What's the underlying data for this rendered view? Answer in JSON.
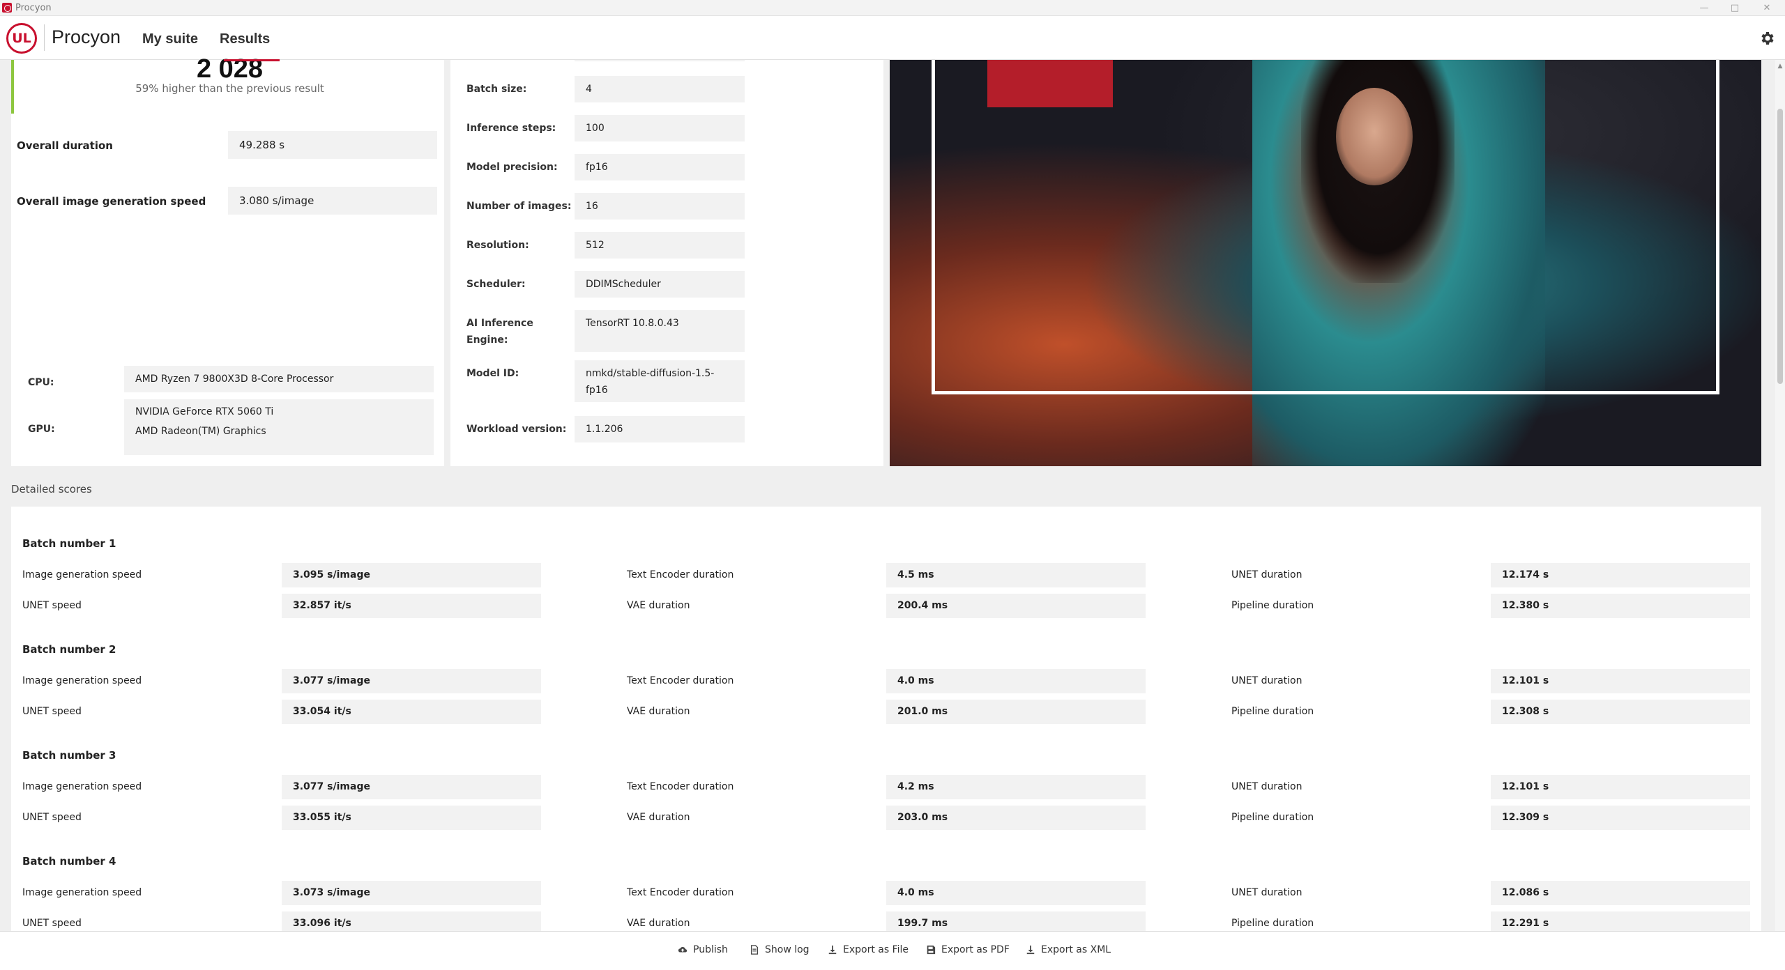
{
  "window": {
    "title": "Procyon"
  },
  "header": {
    "brand": "Procyon",
    "logo_text": "UL",
    "nav": [
      "My suite",
      "Results"
    ]
  },
  "summary": {
    "score": "2 028",
    "score_note": "59% higher than the previous result",
    "overall_duration_label": "Overall duration",
    "overall_duration_value": "49.288 s",
    "overall_speed_label": "Overall image generation speed",
    "overall_speed_value": "3.080 s/image",
    "cpu_label": "CPU:",
    "cpu_value": "AMD Ryzen 7 9800X3D 8-Core Processor",
    "gpu_label": "GPU:",
    "gpu_value_1": "NVIDIA GeForce RTX 5060 Ti",
    "gpu_value_2": "AMD Radeon(TM) Graphics"
  },
  "settings": [
    {
      "label": "Batch size:",
      "value": "4"
    },
    {
      "label": "Inference steps:",
      "value": "100"
    },
    {
      "label": "Model precision:",
      "value": "fp16"
    },
    {
      "label": "Number of images:",
      "value": "16"
    },
    {
      "label": "Resolution:",
      "value": "512"
    },
    {
      "label": "Scheduler:",
      "value": "DDIMScheduler"
    },
    {
      "label_line1": "AI Inference",
      "label_line2": "Engine:",
      "value": "TensorRT 10.8.0.43"
    },
    {
      "label": "Model ID:",
      "value_line1": "nmkd/stable-diffusion-1.5-",
      "value_line2": "fp16"
    },
    {
      "label": "Workload version:",
      "value": "1.1.206"
    }
  ],
  "detailed": {
    "title": "Detailed scores",
    "labels": {
      "img_speed": "Image generation speed",
      "unet_speed": "UNET speed",
      "text_enc": "Text Encoder duration",
      "vae": "VAE duration",
      "unet_dur": "UNET duration",
      "pipeline": "Pipeline duration"
    },
    "batches": [
      {
        "title": "Batch number 1",
        "img_speed": "3.095 s/image",
        "unet_speed": "32.857 it/s",
        "text_enc": "4.5 ms",
        "vae": "200.4 ms",
        "unet_dur": "12.174 s",
        "pipeline": "12.380 s"
      },
      {
        "title": "Batch number 2",
        "img_speed": "3.077 s/image",
        "unet_speed": "33.054 it/s",
        "text_enc": "4.0 ms",
        "vae": "201.0 ms",
        "unet_dur": "12.101 s",
        "pipeline": "12.308 s"
      },
      {
        "title": "Batch number 3",
        "img_speed": "3.077 s/image",
        "unet_speed": "33.055 it/s",
        "text_enc": "4.2 ms",
        "vae": "203.0 ms",
        "unet_dur": "12.101 s",
        "pipeline": "12.309 s"
      },
      {
        "title": "Batch number 4",
        "img_speed": "3.073 s/image",
        "unet_speed": "33.096 it/s",
        "text_enc": "4.0 ms",
        "vae": "199.7 ms",
        "unet_dur": "12.086 s",
        "pipeline": "12.291 s"
      }
    ]
  },
  "footer": {
    "publish": "Publish",
    "show_log": "Show log",
    "export_file": "Export as File",
    "export_pdf": "Export as PDF",
    "export_xml": "Export as XML"
  },
  "icons": [
    "cloud-upload-icon",
    "document-icon",
    "download-icon",
    "save-icon",
    "gear-icon"
  ],
  "colors": {
    "accent_red": "#c8102e",
    "accent_green": "#8dc63f"
  }
}
